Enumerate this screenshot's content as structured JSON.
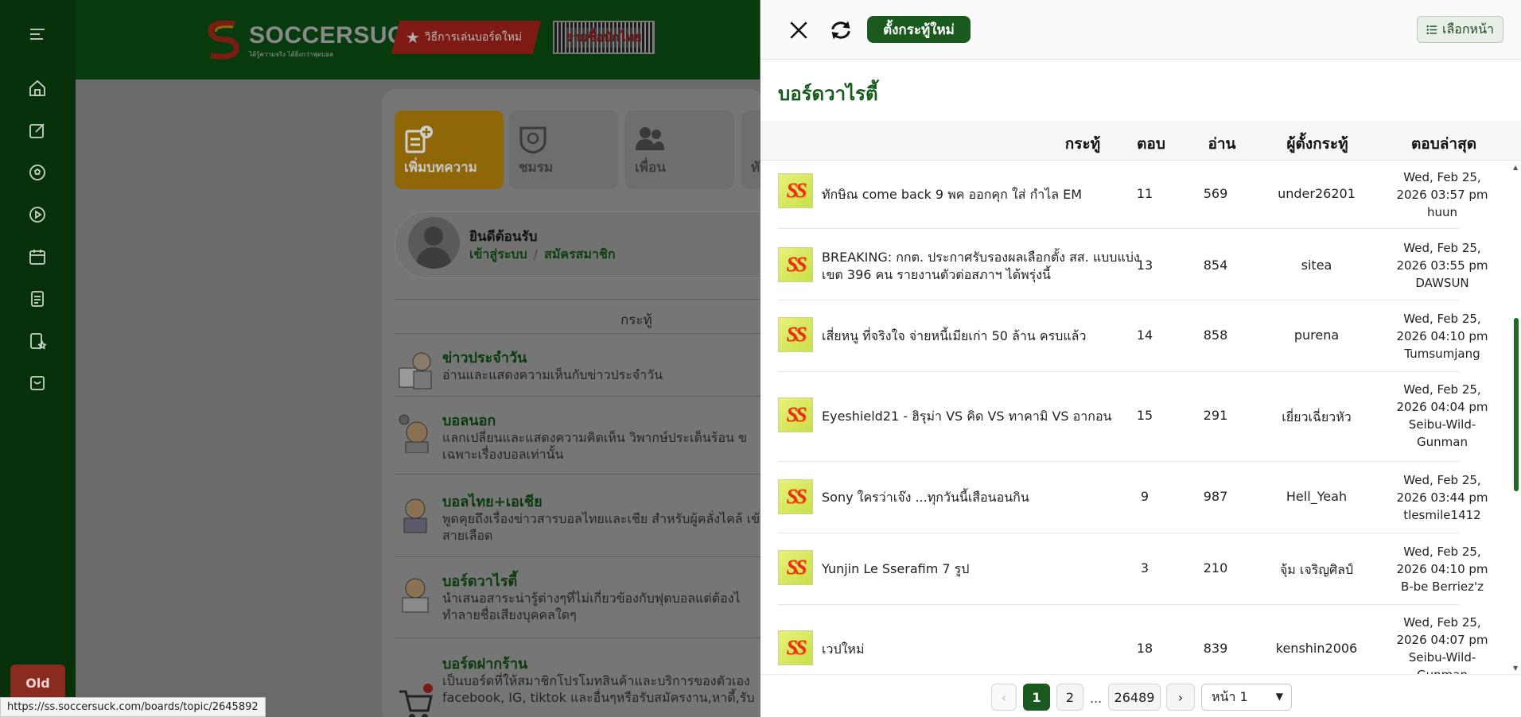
{
  "site": {
    "logo_text_a": "SOCCER",
    "logo_text_b": "SUCK",
    "logo_tagline": "ได้รู้ความจริง ได้ยิ่งกว่าฟุตบอล",
    "howto_label": "วิธีการเล่นบอร์ดใหม่",
    "barcode_label": "รายชื่อบักไทย",
    "old_button": "Old"
  },
  "tiles": [
    {
      "label": "เพิ่มบทความ",
      "icon": "add-post-icon"
    },
    {
      "label": "ชมรม",
      "icon": "club-badge-icon"
    },
    {
      "label": "เพื่อน",
      "icon": "friends-icon"
    },
    {
      "label": "ทั",
      "icon": "partial-icon"
    }
  ],
  "welcome": {
    "title": "ยินดีต้อนรับ",
    "login": "เข้าสู่ระบบ",
    "sep": "/",
    "register": "สมัครสมาชิก"
  },
  "forum_list": {
    "header": "กระทู้",
    "items": [
      {
        "title": "ข่าวประจำวัน",
        "desc": "อ่านและแสดงความเห็นกับข่าวประจำวัน"
      },
      {
        "title": "บอลนอก",
        "desc": "แลกเปลี่ยนและแสดงความคิดเห็น วิพากษ์ประเด็นร้อน ข เฉพาะเรื่องบอลเท่านั้น"
      },
      {
        "title": "บอลไทย+เอเชีย",
        "desc": "พูดคุยถึงเรื่องข่าวสารบอลไทยและเชีย สำหรับผู้คลั่งไคล้ เข้าสายเลือด"
      },
      {
        "title": "บอร์ดวาไรตี้",
        "desc": "นำเสนอสาระน่ารู้ต่างๆที่ไม่เกี่ยวข้องกับฟุตบอลแต่ต้องไ ทำลายชื่อเสียงบุคคลใดๆ"
      },
      {
        "title": "บอร์ดฝากร้าน",
        "desc": "เป็นบอร์ดที่ให้สมาชิกโปรโมทสินค้าและบริการของตัวเอง facebook, IG, tiktok และอื่นๆหรือรับสมัครงาน,หาดี้,รับ"
      }
    ]
  },
  "status_url": "https://ss.soccersuck.com/boards/topic/2645892",
  "drawer": {
    "new_topic_label": "ตั้งกระทู้ใหม่",
    "select_page_label": "เลือกหน้า",
    "board_title": "บอร์ดวาไรตี้",
    "columns": {
      "topic": "กระทู้",
      "replies": "ตอบ",
      "reads": "อ่าน",
      "author": "ผู้ตั้งกระทู้",
      "last_reply": "ตอบล่าสุด"
    },
    "rows": [
      {
        "title": "ทักษิณ come back 9 พค ออกคุก ใส่ กำไล EM",
        "replies": "11",
        "reads": "569",
        "author": "under26201",
        "last_date": "Wed, Feb 25,",
        "last_time": "2026 03:57 pm",
        "last_user": "huun"
      },
      {
        "title": "BREAKING: กกต. ประกาศรับรองผลเลือกตั้ง สส. แบบแบ่งเขต 396 คน รายงานตัวต่อสภาฯ ได้พรุ่งนี้",
        "replies": "13",
        "reads": "854",
        "author": "sitea",
        "last_date": "Wed, Feb 25,",
        "last_time": "2026 03:55 pm",
        "last_user": "DAWSUN"
      },
      {
        "title": "เสี่ยหนู ที่จริงใจ จ่ายหนี้เมียเก่า 50 ล้าน ครบแล้ว",
        "replies": "14",
        "reads": "858",
        "author": "purena",
        "last_date": "Wed, Feb 25,",
        "last_time": "2026 04:10 pm",
        "last_user": "Tumsumjang"
      },
      {
        "title": "Eyeshield21 - ฮิรุม่า VS คิด VS ทาคามิ VS อากอน",
        "replies": "15",
        "reads": "291",
        "author": "เยี่ยวเฉี่ยวหัว",
        "last_date": "Wed, Feb 25,",
        "last_time": "2026 04:04 pm",
        "last_user": "Seibu-Wild-Gunman"
      },
      {
        "title": "Sony ใครว่าเจ๊ง ...ทุกวันนี้เสือนอนกิน",
        "replies": "9",
        "reads": "987",
        "author": "Hell_Yeah",
        "last_date": "Wed, Feb 25,",
        "last_time": "2026 03:44 pm",
        "last_user": "tlesmile1412"
      },
      {
        "title": "Yunjin Le Sserafim 7 รูป",
        "replies": "3",
        "reads": "210",
        "author": "จุ้ม เจริญศิลป์",
        "last_date": "Wed, Feb 25,",
        "last_time": "2026 04:10 pm",
        "last_user": "B-be Berriez'z"
      },
      {
        "title": "เวปใหม่",
        "replies": "18",
        "reads": "839",
        "author": "kenshin2006",
        "last_date": "Wed, Feb 25,",
        "last_time": "2026 04:07 pm",
        "last_user": "Seibu-Wild-Gunman"
      }
    ],
    "pagination": {
      "prev": "‹",
      "pages": [
        "1",
        "2"
      ],
      "dots": "...",
      "last_page": "26489",
      "next": "›",
      "select_value": "หน้า 1",
      "current": "1"
    }
  },
  "colors": {
    "brand_green": "#1a5a1e",
    "title_green": "#145d1b",
    "scroll_thumb": "#1a6a20"
  }
}
